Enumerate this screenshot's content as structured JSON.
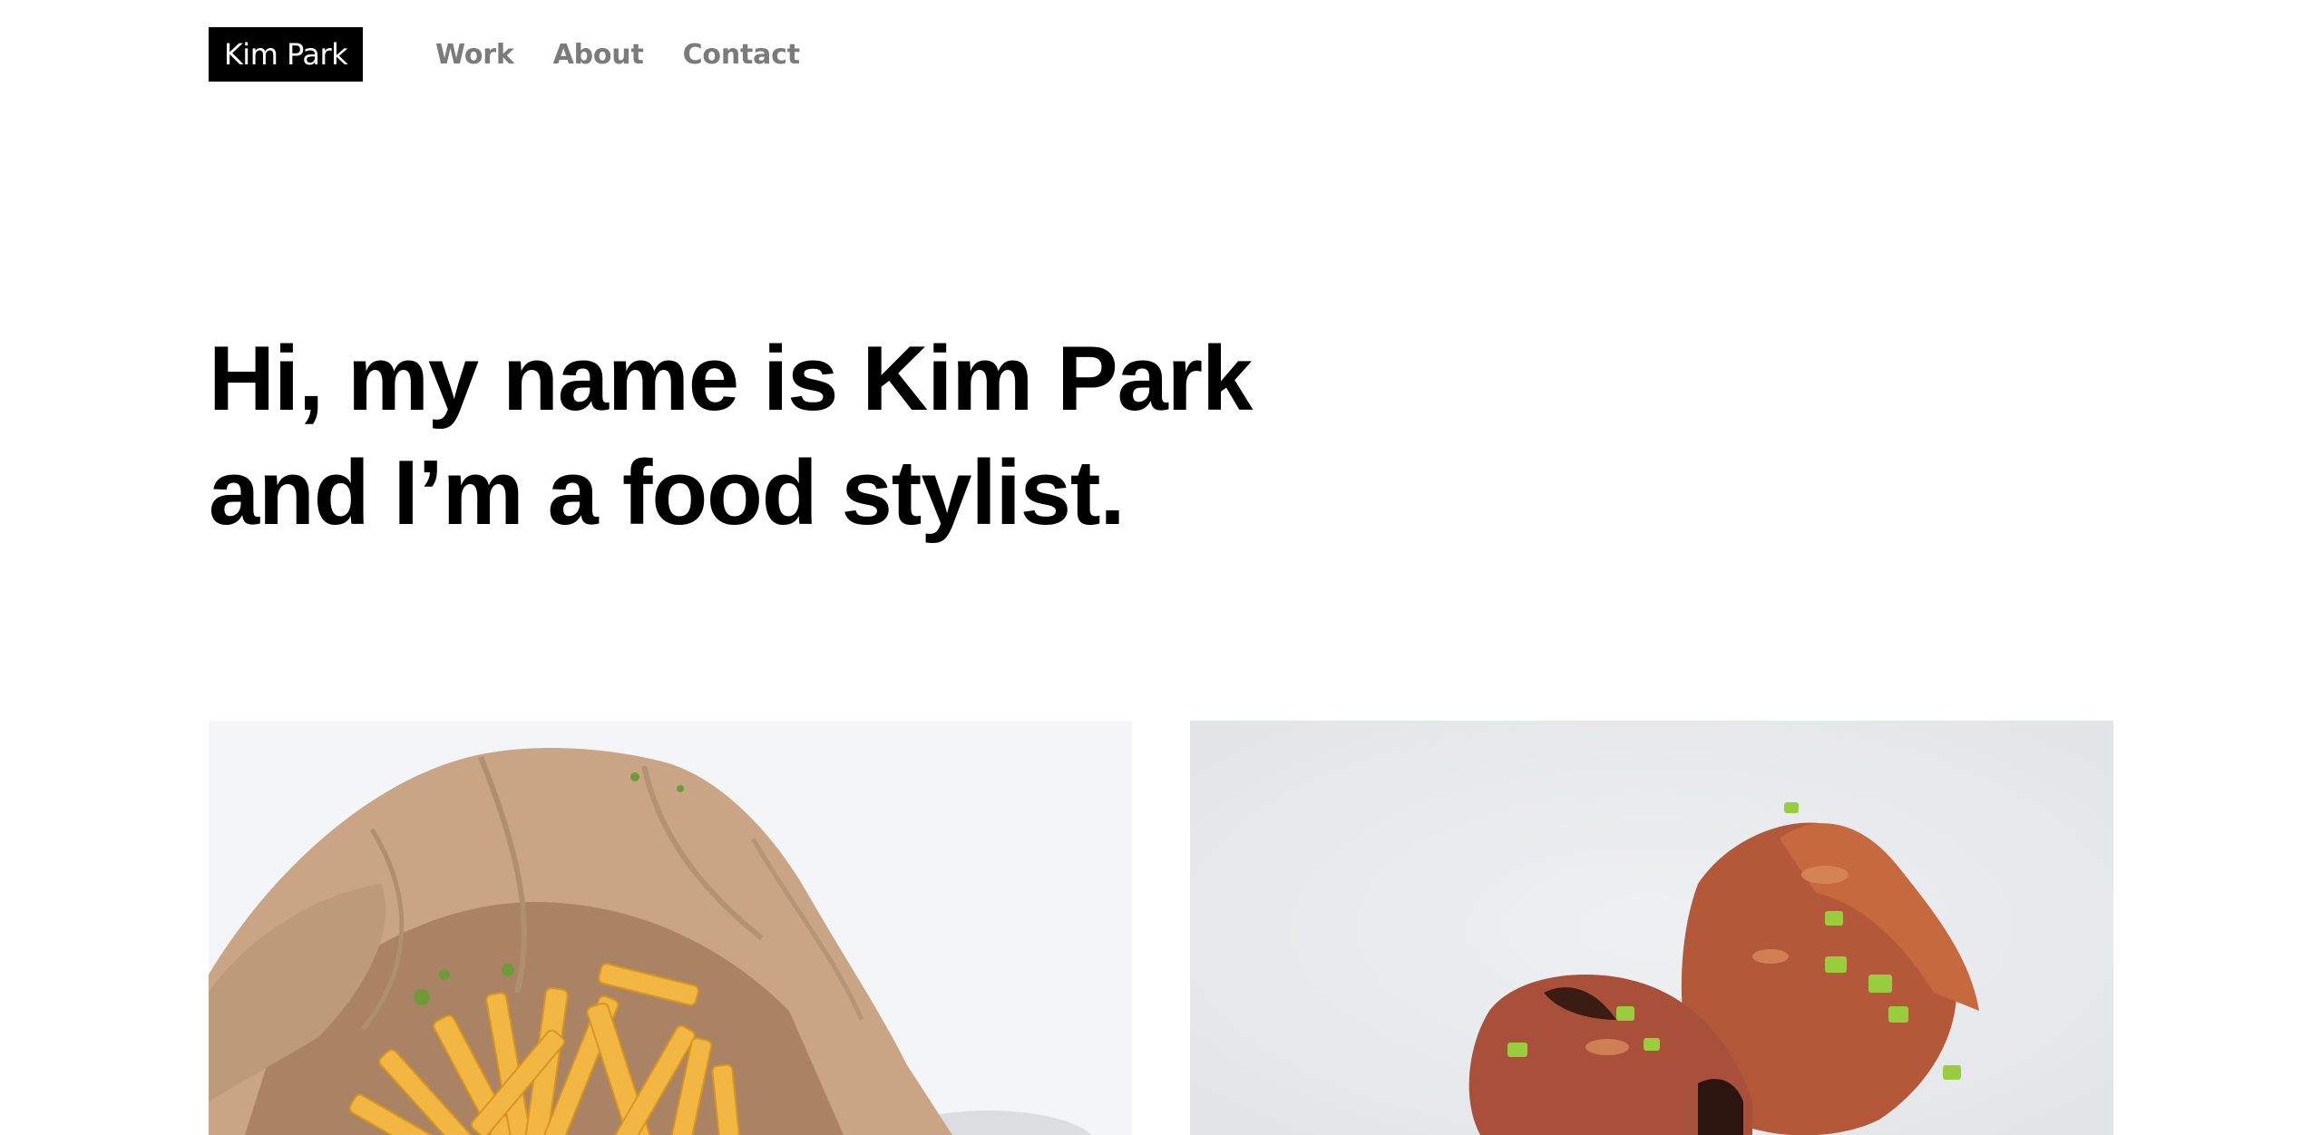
{
  "header": {
    "logo_text": "Kim Park",
    "nav": [
      {
        "label": "Work"
      },
      {
        "label": "About"
      },
      {
        "label": "Contact"
      }
    ]
  },
  "hero": {
    "line1": "Hi, my name is Kim Park",
    "line2": "and I’m a food stylist."
  },
  "gallery": {
    "items": [
      {
        "subject": "french fries in paper bag"
      },
      {
        "subject": "glazed fried chicken with scallions"
      }
    ]
  },
  "colors": {
    "logo_bg": "#000000",
    "logo_text": "#ffffff",
    "nav_text": "#7b7b7b",
    "hero_text": "#000000",
    "background": "#ffffff"
  }
}
